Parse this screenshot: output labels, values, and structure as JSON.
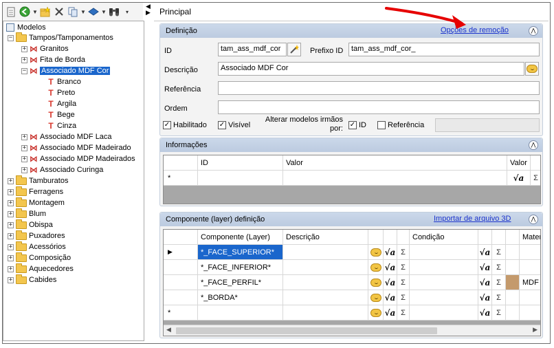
{
  "toolbar": {
    "icons": [
      "page-icon",
      "back-circle-icon",
      "new-folder-icon",
      "delete-icon",
      "copy-icon",
      "move-icon",
      "binoculars-icon"
    ]
  },
  "tree": {
    "root": "Modelos",
    "tampos": "Tampos/Tamponamentos",
    "granitos": "Granitos",
    "fita": "Fita de Borda",
    "assoc_mdf_cor": "Associado MDF Cor",
    "branco": "Branco",
    "preto": "Preto",
    "argila": "Argila",
    "bege": "Bege",
    "cinza": "Cinza",
    "assoc_laca": "Associado MDF Laca",
    "assoc_madeirado": "Associado MDF Madeirado",
    "assoc_mdp": "Associado MDP Madeirados",
    "assoc_curinga": "Associado Curinga",
    "tamburatos": "Tamburatos",
    "ferragens": "Ferragens",
    "montagem": "Montagem",
    "blum": "Blum",
    "obispa": "Obispa",
    "puxadores": "Puxadores",
    "acessorios": "Acessórios",
    "composicao": "Composição",
    "aquecedores": "Aquecedores",
    "cabides": "Cabides"
  },
  "main": {
    "tab_title": "Principal",
    "definicao": {
      "title": "Definição",
      "remove_options_link": "Opções de remoção",
      "id_label": "ID",
      "id_value": "tam_ass_mdf_cor",
      "prefix_label": "Prefixo ID",
      "prefix_value": "tam_ass_mdf_cor_",
      "desc_label": "Descrição",
      "desc_value": "Associado MDF Cor",
      "ref_label": "Referência",
      "ref_value": "",
      "ordem_label": "Ordem",
      "ordem_value": "",
      "habilitado": "Habilitado",
      "visivel": "Visível",
      "alterar_line1": "Alterar modelos irmãos",
      "alterar_line2": "por:",
      "cb_id": "ID",
      "cb_ref": "Referência"
    },
    "informacoes": {
      "title": "Informações",
      "col_id": "ID",
      "col_valor": "Valor",
      "col_valor2": "Valor",
      "new_row_marker": "*"
    },
    "componente": {
      "title": "Componente (layer) definição",
      "import_link": "Importar de arquivo 3D",
      "col_layer": "Componente (Layer)",
      "col_desc": "Descrição",
      "col_cond": "Condição",
      "col_mat": "Mater",
      "rows": [
        {
          "layer": "*_FACE_SUPERIOR*",
          "mat": ""
        },
        {
          "layer": "*_FACE_INFERIOR*",
          "mat": ""
        },
        {
          "layer": "*_FACE_PERFIL*",
          "mat": "MDF C"
        },
        {
          "layer": "*_BORDA*",
          "mat": ""
        }
      ],
      "new_row_marker": "*",
      "current_row_marker": "▶"
    },
    "sigma": "Σ"
  }
}
